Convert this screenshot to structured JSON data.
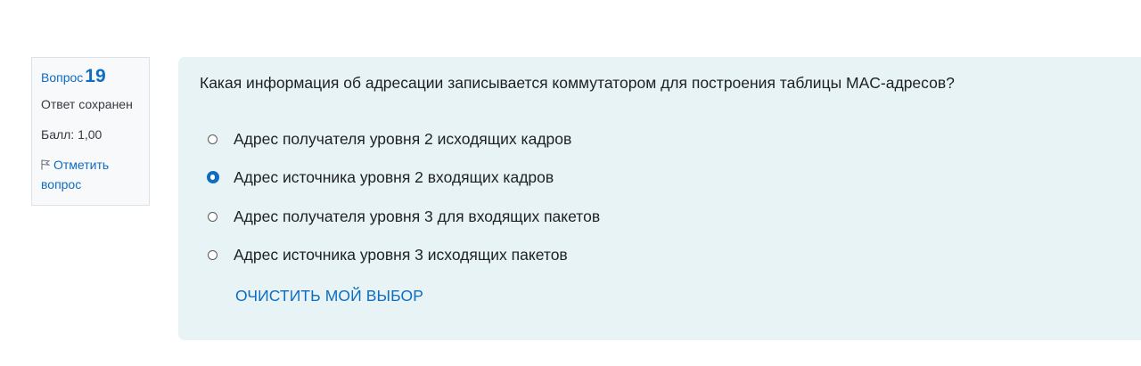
{
  "question_info": {
    "label": "Вопрос",
    "number": "19",
    "state": "Ответ сохранен",
    "grade": "Балл: 1,00",
    "flag_label": "Отметить вопрос",
    "flag_line1": "Отметить",
    "flag_line2": "вопрос"
  },
  "question": {
    "text": "Какая информация об адресации записывается коммутатором для построения таблицы MAC-адресов?",
    "answers": [
      {
        "label": "Адрес получателя уровня 2 исходящих кадров",
        "selected": false
      },
      {
        "label": "Адрес источника уровня 2 входящих кадров",
        "selected": true
      },
      {
        "label": "Адрес получателя уровня 3 для входящих пакетов",
        "selected": false
      },
      {
        "label": "Адрес источника уровня 3 исходящих пакетов",
        "selected": false
      }
    ],
    "clear_label": "ОЧИСТИТЬ МОЙ ВЫБОР"
  },
  "colors": {
    "accent": "#0f6cbf",
    "content_bg": "#e7f3f5",
    "info_bg": "#f8f9fa"
  },
  "icons": {
    "flag": "flag-icon"
  }
}
